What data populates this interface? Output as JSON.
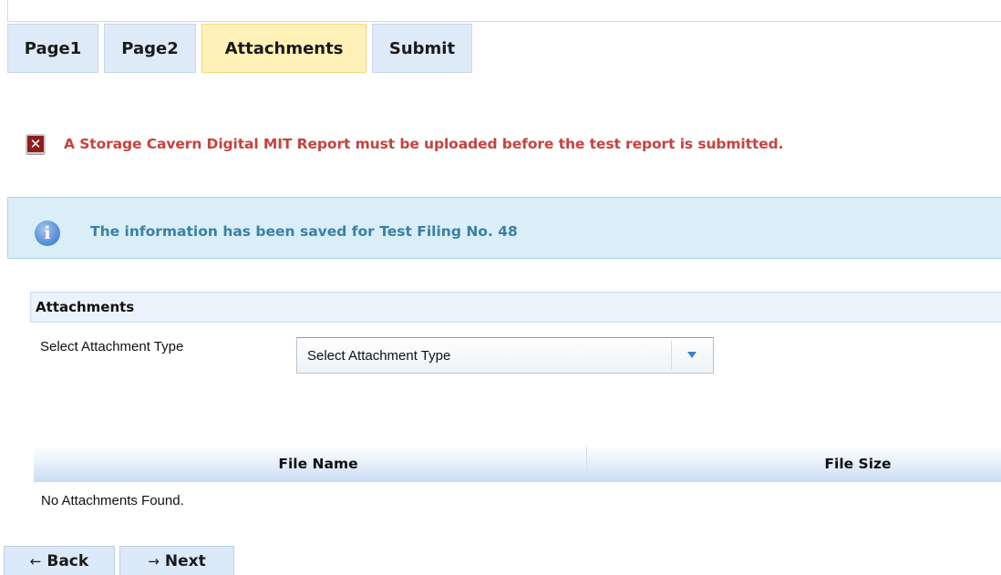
{
  "tabs": [
    {
      "label": "Page1",
      "active": false
    },
    {
      "label": "Page2",
      "active": false
    },
    {
      "label": "Attachments",
      "active": true
    },
    {
      "label": "Submit",
      "active": false
    }
  ],
  "error": {
    "icon": "error-x-icon",
    "message": "A Storage Cavern Digital MIT Report must be uploaded before the test report is submitted."
  },
  "info": {
    "icon": "info-icon",
    "message": "The information has been saved for Test Filing No. 48"
  },
  "attachments": {
    "section_title": "Attachments",
    "type_label": "Select Attachment Type",
    "type_select_value": "Select Attachment Type",
    "columns": [
      "File Name",
      "File Size"
    ],
    "empty_message": "No Attachments Found."
  },
  "nav": {
    "back_label": "Back",
    "next_label": "Next"
  },
  "colors": {
    "tab_bg": "#dfeaf8",
    "tab_active_bg": "#fff1b8",
    "error_text": "#c9413d",
    "info_bg": "#d9eef6",
    "info_text": "#3c7fa5"
  }
}
